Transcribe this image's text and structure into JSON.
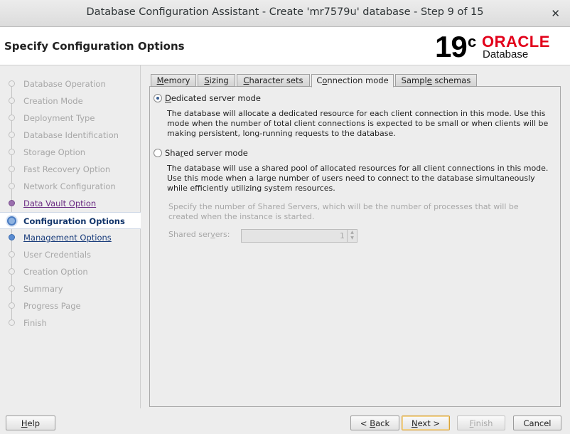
{
  "window": {
    "title": "Database Configuration Assistant - Create 'mr7579u' database - Step 9 of 15",
    "close_glyph": "✕"
  },
  "header": {
    "step_title": "Specify Configuration Options",
    "logo": {
      "version": "19",
      "version_sup": "c",
      "brand": "ORACLE",
      "product": "Database"
    }
  },
  "sidebar": {
    "items": [
      {
        "label": "Database Operation",
        "state": "done"
      },
      {
        "label": "Creation Mode",
        "state": "done"
      },
      {
        "label": "Deployment Type",
        "state": "done"
      },
      {
        "label": "Database Identification",
        "state": "done"
      },
      {
        "label": "Storage Option",
        "state": "done"
      },
      {
        "label": "Fast Recovery Option",
        "state": "done"
      },
      {
        "label": "Network Configuration",
        "state": "done"
      },
      {
        "label": "Data Vault Option",
        "state": "visited"
      },
      {
        "label": "Configuration Options",
        "state": "current"
      },
      {
        "label": "Management Options",
        "state": "link"
      },
      {
        "label": "User Credentials",
        "state": "pending"
      },
      {
        "label": "Creation Option",
        "state": "pending"
      },
      {
        "label": "Summary",
        "state": "pending"
      },
      {
        "label": "Progress Page",
        "state": "pending"
      },
      {
        "label": "Finish",
        "state": "pending"
      }
    ]
  },
  "tabs": [
    {
      "pre": "",
      "ul": "M",
      "post": "emory",
      "active": false
    },
    {
      "pre": "",
      "ul": "S",
      "post": "izing",
      "active": false
    },
    {
      "pre": "",
      "ul": "C",
      "post": "haracter sets",
      "active": false
    },
    {
      "pre": "C",
      "ul": "o",
      "post": "nnection mode",
      "active": true
    },
    {
      "pre": "Sampl",
      "ul": "e",
      "post": " schemas",
      "active": false
    }
  ],
  "connection": {
    "dedicated": {
      "label_pre": "",
      "label_ul": "D",
      "label_post": "edicated server mode",
      "selected": true,
      "description": "The database will allocate a dedicated resource for each client connection in this mode. Use this mode when the number of total client connections is expected to be small or when clients will be making persistent, long-running requests to the database."
    },
    "shared": {
      "label_pre": "Sha",
      "label_ul": "r",
      "label_post": "ed server mode",
      "selected": false,
      "description": "The database will use a shared pool of allocated resources for all client connections in this mode.  Use this mode when a large number of users need to connect to the database simultaneously while efficiently utilizing system resources."
    },
    "shared_servers_help": "Specify the number of Shared Servers, which will be the number of processes that will be created when the instance is started.",
    "shared_servers_label_pre": "Shared ser",
    "shared_servers_label_ul": "v",
    "shared_servers_label_post": "ers:",
    "shared_servers_value": "1"
  },
  "footer": {
    "help": {
      "ul": "H",
      "post": "elp"
    },
    "back": {
      "pre": "< ",
      "ul": "B",
      "post": "ack"
    },
    "next": {
      "ul": "N",
      "post": "ext >"
    },
    "finish": {
      "ul": "F",
      "post": "inish"
    },
    "cancel": {
      "label": "Cancel"
    }
  }
}
